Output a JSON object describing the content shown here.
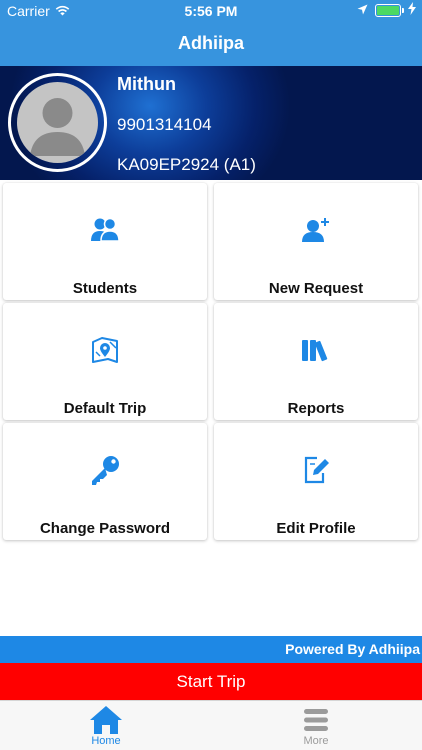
{
  "status_bar": {
    "carrier": "Carrier",
    "time": "5:56 PM"
  },
  "nav": {
    "title": "Adhiipa"
  },
  "profile": {
    "name": "Mithun",
    "phone": "9901314104",
    "vehicle": "KA09EP2924 (A1)"
  },
  "tiles": [
    {
      "label": "Students",
      "icon": "students-icon"
    },
    {
      "label": "New Request",
      "icon": "add-person-icon"
    },
    {
      "label": "Default Trip",
      "icon": "map-pin-icon"
    },
    {
      "label": "Reports",
      "icon": "books-icon"
    },
    {
      "label": "Change Password",
      "icon": "key-icon"
    },
    {
      "label": "Edit Profile",
      "icon": "edit-document-icon"
    }
  ],
  "footer": {
    "powered_by": "Powered By Adhiipa",
    "start_trip": "Start Trip"
  },
  "tabbar": [
    {
      "label": "Home",
      "icon": "home-icon",
      "active": true
    },
    {
      "label": "More",
      "icon": "menu-icon",
      "active": false
    }
  ],
  "colors": {
    "primary_blue": "#3794de",
    "accent_blue": "#1e88e5",
    "start_trip_red": "#ff0000",
    "banner_dark_blue": "#05216a",
    "battery_green": "#4cd964"
  }
}
